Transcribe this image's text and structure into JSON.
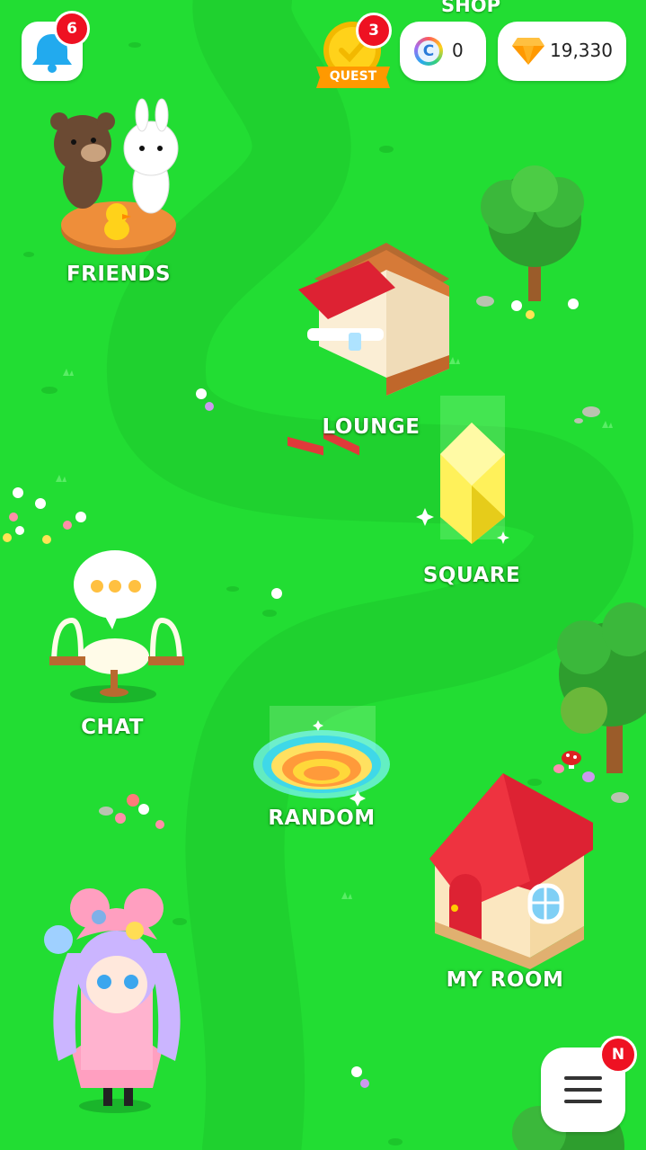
{
  "hud": {
    "notifications_badge": "6",
    "quest_label": "QUEST",
    "quest_badge": "3",
    "shop_label": "SHOP",
    "coin_symbol": "C",
    "coin_amount": "0",
    "gem_amount": "19,330",
    "menu_badge": "N"
  },
  "locations": {
    "friends": "FRIENDS",
    "lounge": "LOUNGE",
    "square": "SQUARE",
    "chat": "CHAT",
    "random": "RANDOM",
    "my_room": "MY ROOM"
  },
  "colors": {
    "grass": "#22dd33",
    "path": "#1ed02e",
    "badge_red": "#ee1122",
    "bell_blue": "#22aaee",
    "quest_gold": "#ffd21a",
    "roof_red": "#dd2233",
    "gem_orange": "#ff9900"
  },
  "icons": {
    "notifications": "bell-icon",
    "quest": "quest-medal-icon",
    "coin": "coin-icon",
    "gem": "gem-icon",
    "menu": "hamburger-menu-icon"
  }
}
